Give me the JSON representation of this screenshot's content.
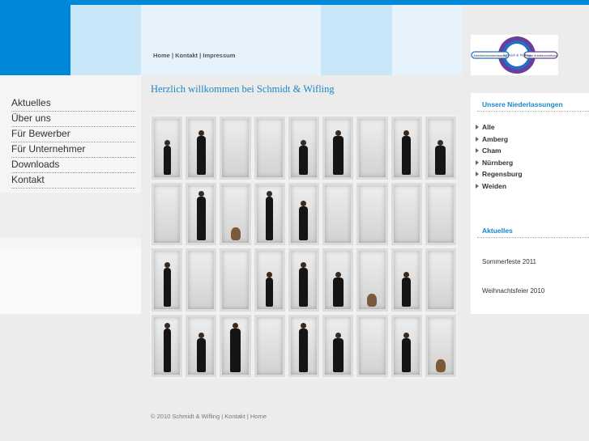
{
  "header": {
    "nav": [
      "Home",
      "Kontakt",
      "Impressum"
    ],
    "separator": "|",
    "logo_name": "Schmidt & Wifling",
    "logo_left_tag": "Arbeitnehmerüberlassung",
    "logo_right_tag": "Private Arbeitsvermittlung"
  },
  "sidebar": {
    "items": [
      "Aktuelles",
      "Über uns",
      "Für Bewerber",
      "Für Unternehmer",
      "Downloads",
      "Kontakt"
    ]
  },
  "main": {
    "title": "Herzlich willkommen bei Schmidt & Wifling"
  },
  "right": {
    "locations_heading": "Unsere Niederlassungen",
    "locations": [
      "Alle",
      "Amberg",
      "Cham",
      "Nürnberg",
      "Regensburg",
      "Weiden"
    ],
    "news_heading": "Aktuelles",
    "news": [
      "Sommerfeste 2011",
      "Weihnachtsfeier 2010"
    ]
  },
  "footer": {
    "copyright": "© 2010 Schmidt & Wifling",
    "links": [
      "Kontakt",
      "Home"
    ],
    "separator": "|"
  },
  "colors": {
    "brand_blue": "#0088d8",
    "light_blue": "#c9e5f8",
    "pale_blue": "#e6f3fc",
    "heading_blue": "#1a87c7"
  }
}
